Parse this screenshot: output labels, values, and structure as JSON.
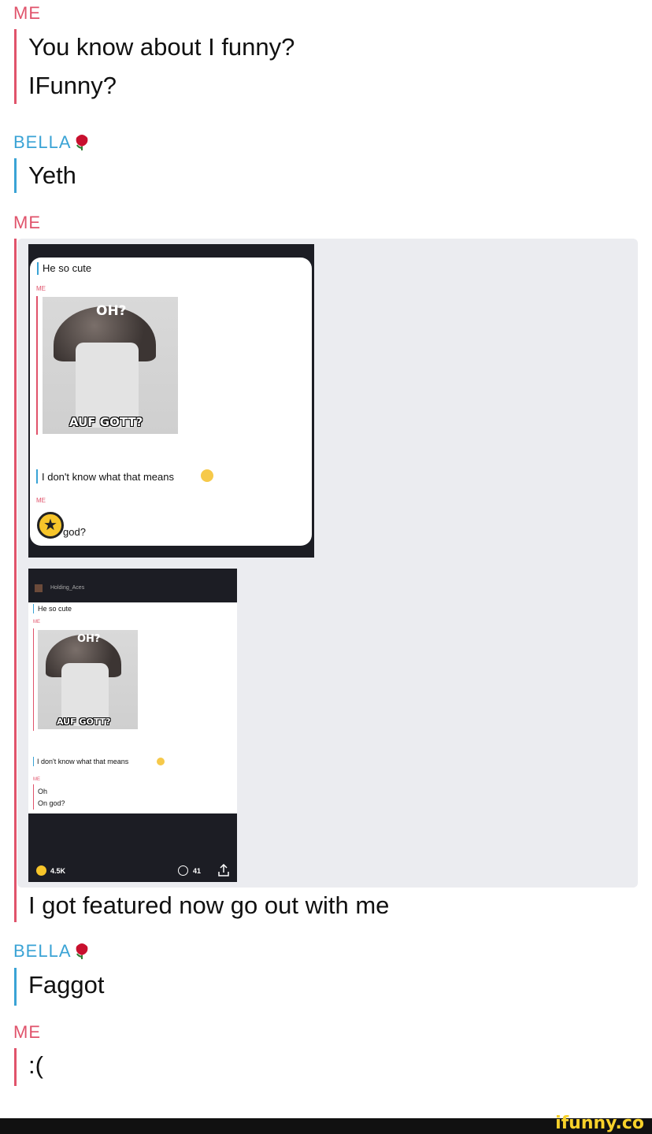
{
  "messages": [
    {
      "sender": "ME",
      "lines": [
        "You know about I funny?",
        "IFunny?"
      ]
    },
    {
      "sender": "BELLA",
      "lines": [
        "Yeth"
      ]
    },
    {
      "sender": "ME",
      "lines": [
        "I got featured now go out with me"
      ]
    },
    {
      "sender": "BELLA",
      "lines": [
        "Faɡɡot"
      ]
    },
    {
      "sender": "ME",
      "lines": [
        ":("
      ]
    }
  ],
  "shot1": {
    "line1": "He so cute",
    "sender_me": "ME",
    "meme_top": "OH?",
    "meme_bottom": "AUF GOTT?",
    "line2": "I don't know what that means",
    "sender_me2": "ME",
    "line3": "god?"
  },
  "shot2": {
    "username": "Holding_Aces",
    "line1": "He so cute",
    "sender_me": "ME",
    "meme_top": "OH?",
    "meme_bottom": "AUF GOTT?",
    "line2": "I don't know what that means",
    "sender_me2": "ME",
    "line3": "Oh",
    "line4": "On god?",
    "smiles": "4.5K",
    "comments": "41"
  },
  "footer": {
    "logo": "ifunny.co"
  },
  "colors": {
    "me": "#e0536b",
    "bella": "#3aa3d5"
  }
}
